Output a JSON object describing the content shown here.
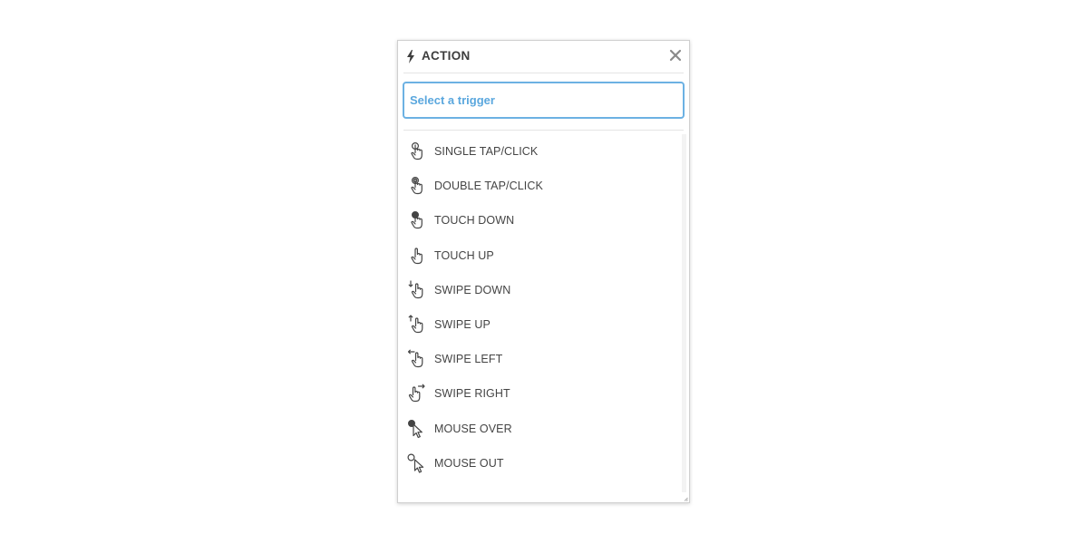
{
  "panel": {
    "title": "ACTION",
    "close_icon": "close-icon",
    "title_icon": "lightning-bolt-icon"
  },
  "search": {
    "placeholder": "Select a trigger",
    "value": ""
  },
  "triggers": [
    {
      "label": "SINGLE TAP/CLICK",
      "icon": "single-tap-icon"
    },
    {
      "label": "DOUBLE TAP/CLICK",
      "icon": "double-tap-icon"
    },
    {
      "label": "TOUCH DOWN",
      "icon": "touch-down-icon"
    },
    {
      "label": "TOUCH UP",
      "icon": "touch-up-icon"
    },
    {
      "label": "SWIPE DOWN",
      "icon": "swipe-down-icon"
    },
    {
      "label": "SWIPE UP",
      "icon": "swipe-up-icon"
    },
    {
      "label": "SWIPE LEFT",
      "icon": "swipe-left-icon"
    },
    {
      "label": "SWIPE RIGHT",
      "icon": "swipe-right-icon"
    },
    {
      "label": "MOUSE OVER",
      "icon": "mouse-over-icon"
    },
    {
      "label": "MOUSE OUT",
      "icon": "mouse-out-icon"
    }
  ],
  "colors": {
    "accent": "#6cb1e3",
    "text": "#444444",
    "border": "#cfcfcf"
  }
}
